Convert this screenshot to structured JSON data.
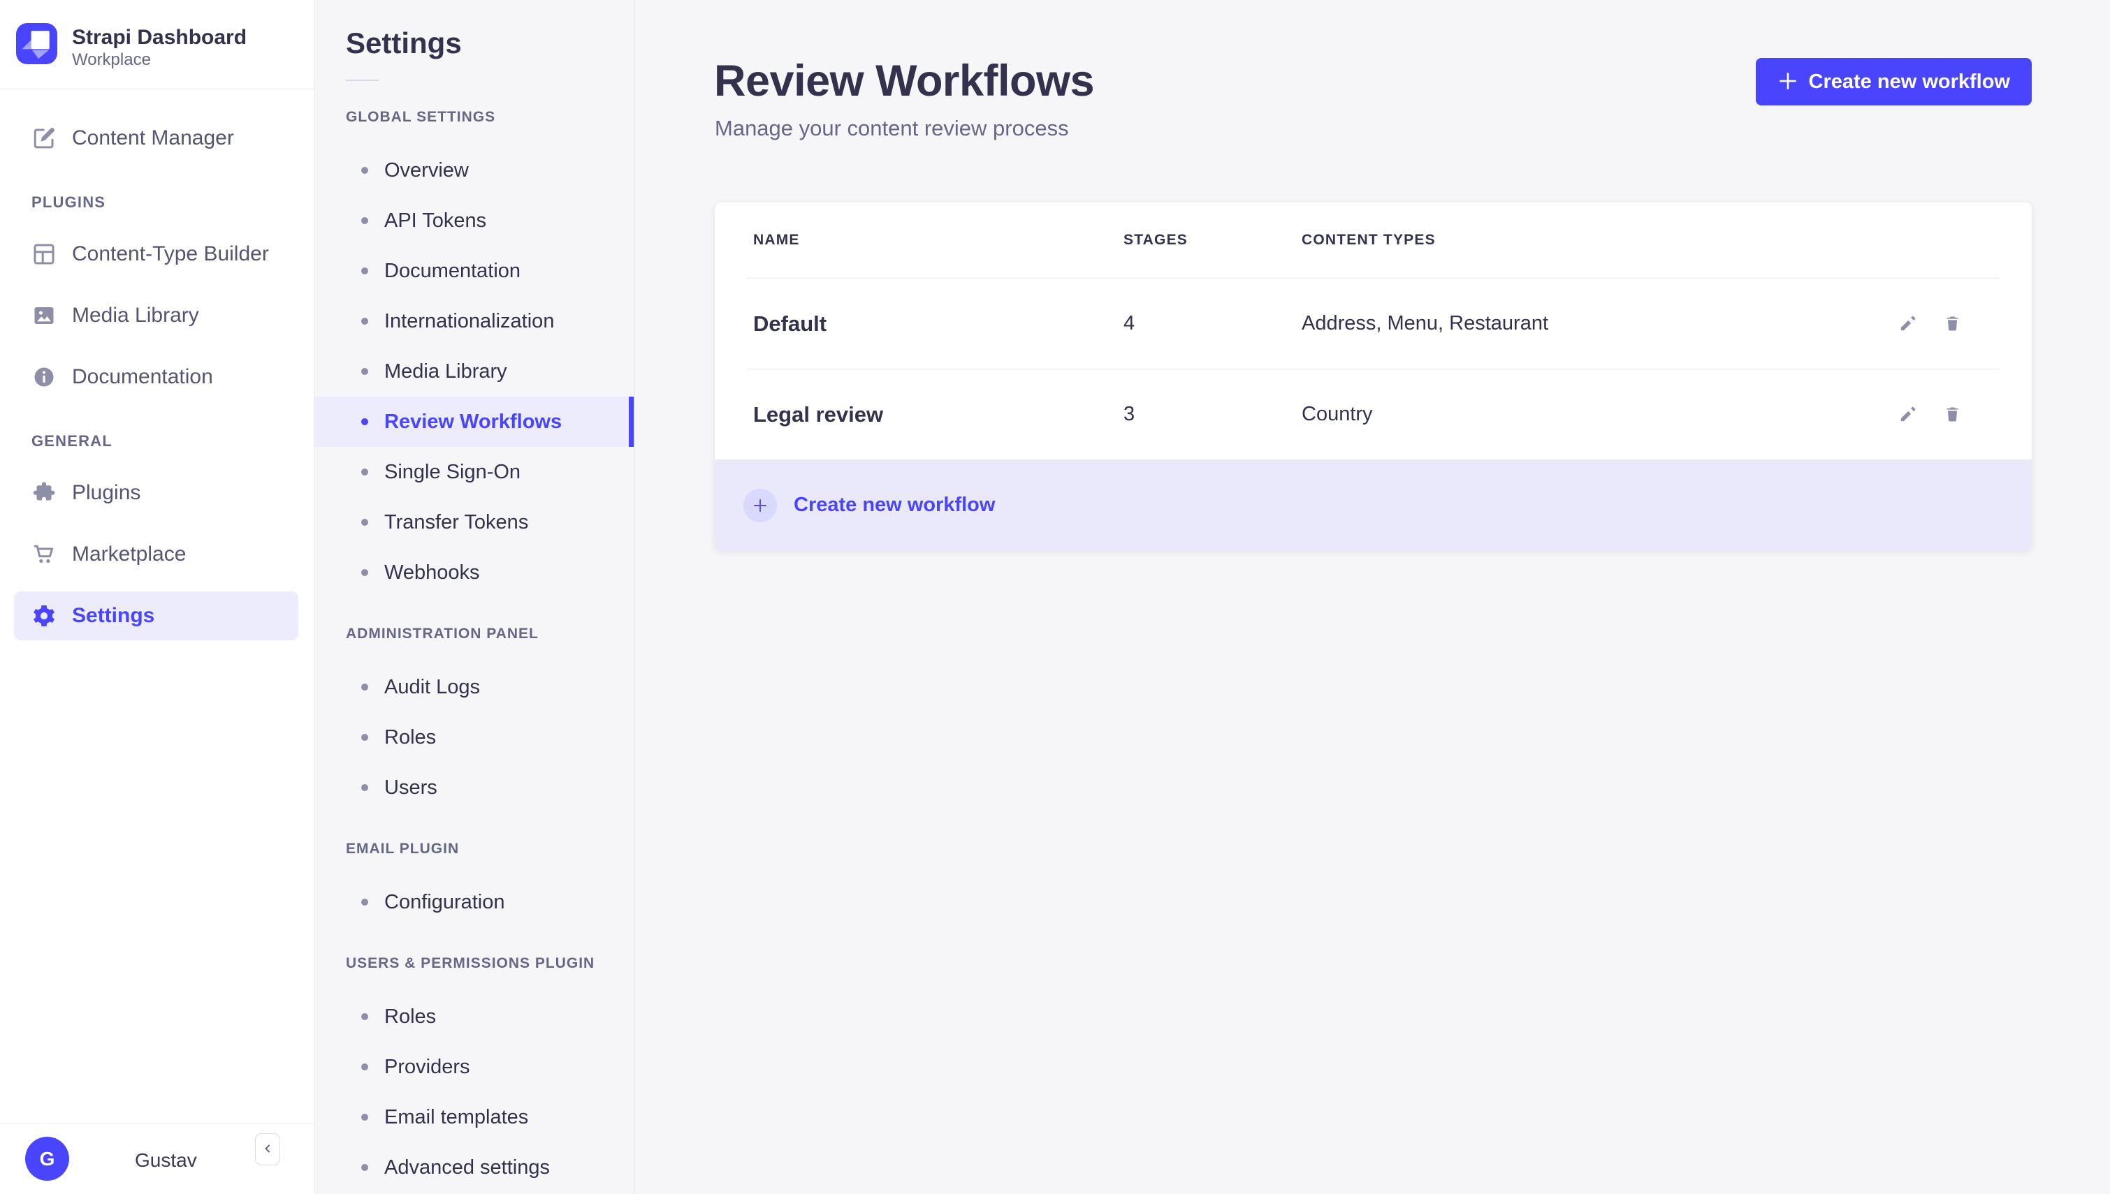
{
  "app": {
    "title": "Strapi Dashboard",
    "subtitle": "Workplace"
  },
  "main_nav": {
    "sections": [
      {
        "label": "",
        "items": [
          {
            "label": "Content Manager",
            "icon": "pen"
          }
        ]
      },
      {
        "label": "PLUGINS",
        "items": [
          {
            "label": "Content-Type Builder",
            "icon": "layout"
          },
          {
            "label": "Media Library",
            "icon": "picture"
          },
          {
            "label": "Documentation",
            "icon": "info"
          }
        ]
      },
      {
        "label": "GENERAL",
        "items": [
          {
            "label": "Plugins",
            "icon": "puzzle"
          },
          {
            "label": "Marketplace",
            "icon": "cart"
          },
          {
            "label": "Settings",
            "icon": "gear",
            "active": true
          }
        ]
      }
    ],
    "user": {
      "initial": "G",
      "name": "Gustav"
    }
  },
  "subnav": {
    "title": "Settings",
    "sections": [
      {
        "label": "GLOBAL SETTINGS",
        "items": [
          {
            "label": "Overview"
          },
          {
            "label": "API Tokens"
          },
          {
            "label": "Documentation"
          },
          {
            "label": "Internationalization"
          },
          {
            "label": "Media Library"
          },
          {
            "label": "Review Workflows",
            "active": true
          },
          {
            "label": "Single Sign-On"
          },
          {
            "label": "Transfer Tokens"
          },
          {
            "label": "Webhooks"
          }
        ]
      },
      {
        "label": "ADMINISTRATION PANEL",
        "items": [
          {
            "label": "Audit Logs"
          },
          {
            "label": "Roles"
          },
          {
            "label": "Users"
          }
        ]
      },
      {
        "label": "EMAIL PLUGIN",
        "items": [
          {
            "label": "Configuration"
          }
        ]
      },
      {
        "label": "USERS & PERMISSIONS PLUGIN",
        "items": [
          {
            "label": "Roles"
          },
          {
            "label": "Providers"
          },
          {
            "label": "Email templates"
          },
          {
            "label": "Advanced settings"
          }
        ]
      }
    ]
  },
  "page": {
    "title": "Review Workflows",
    "subtitle": "Manage your content review process",
    "create_button": "Create new workflow"
  },
  "table": {
    "columns": [
      "NAME",
      "STAGES",
      "CONTENT TYPES"
    ],
    "rows": [
      {
        "name": "Default",
        "stages": "4",
        "content_types": "Address, Menu, Restaurant"
      },
      {
        "name": "Legal review",
        "stages": "3",
        "content_types": "Country"
      }
    ],
    "footer_action": "Create new workflow"
  },
  "colors": {
    "primary": "#4945ff",
    "primary_light": "#edecfc",
    "primary_lighter": "#d9d8ff",
    "footer_row_bg": "#eae9fc",
    "text_dark": "#32324d",
    "text_gray": "#666687",
    "icon_gray": "#8e8ea9",
    "border": "#eaeaef",
    "page_bg": "#f6f6f9",
    "sidebar_bg": "#ffffff"
  }
}
